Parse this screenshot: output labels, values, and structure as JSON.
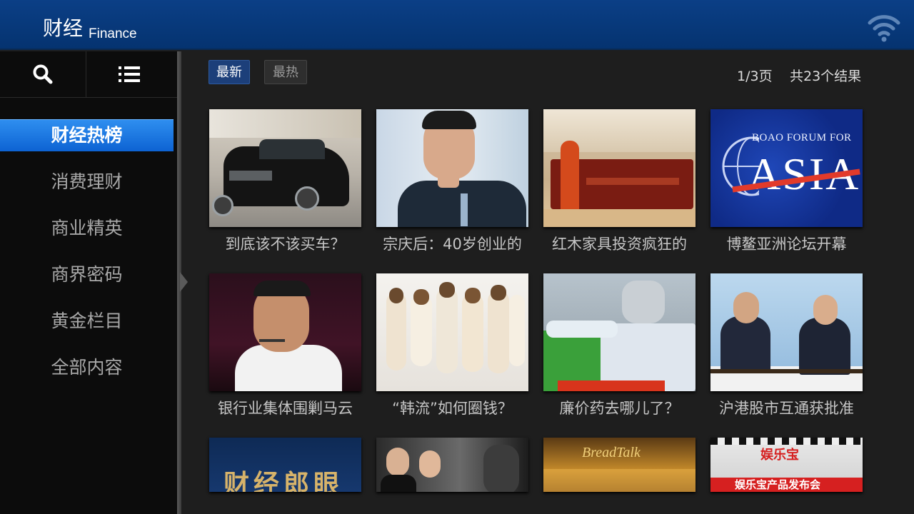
{
  "header": {
    "title": "财经",
    "subtitle": "Finance",
    "wifi_icon": "wifi-icon"
  },
  "toolbar": {
    "search_icon": "search-icon",
    "menu_icon": "list-icon"
  },
  "sidebar": {
    "items": [
      {
        "label": "财经热榜",
        "active": true
      },
      {
        "label": "消费理财",
        "active": false
      },
      {
        "label": "商业精英",
        "active": false
      },
      {
        "label": "商界密码",
        "active": false
      },
      {
        "label": "黄金栏目",
        "active": false
      },
      {
        "label": "全部内容",
        "active": false
      }
    ]
  },
  "sort": {
    "latest_label": "最新",
    "hot_label": "最热"
  },
  "pagination": {
    "page_text": "1/3页",
    "result_text": "共23个结果"
  },
  "grid": {
    "rows": [
      [
        {
          "caption": "到底该不该买车？"
        },
        {
          "caption": "宗庆后：40岁创业的"
        },
        {
          "caption": "红木家具投资疯狂的"
        },
        {
          "caption": "博鳌亚洲论坛开幕"
        }
      ],
      [
        {
          "caption": "银行业集体围剿马云"
        },
        {
          "caption": "“韩流”如何圈钱？"
        },
        {
          "caption": "廉价药去哪儿了？"
        },
        {
          "caption": "沪港股市互通获批准"
        }
      ],
      [
        {
          "caption": ""
        },
        {
          "caption": ""
        },
        {
          "caption": ""
        },
        {
          "caption": ""
        }
      ]
    ],
    "thumb_texts": {
      "asia_forum": "BOAO FORUM FOR",
      "asia_big": "ASIA",
      "row3_1": "财经郎眼",
      "row3_3": "BreadTalk",
      "row3_4_logo": "娱乐宝",
      "row3_4_banner": "娱乐宝产品发布会"
    }
  },
  "colors": {
    "header_bg": "#053370",
    "active_nav": "#1a78e6",
    "sidebar_bg": "#0c0c0c",
    "content_bg": "#1e1e1e"
  }
}
